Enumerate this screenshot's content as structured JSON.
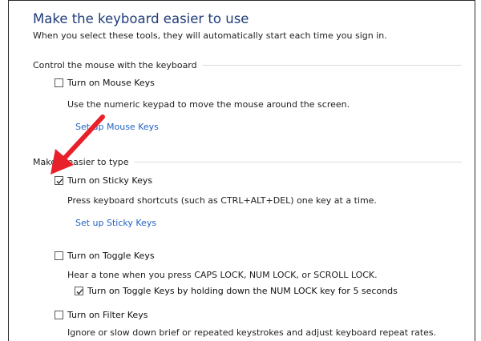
{
  "header": {
    "title": "Make the keyboard easier to use",
    "subtitle": "When you select these tools, they will automatically start each time you sign in."
  },
  "groups": {
    "mouse": {
      "header": "Control the mouse with the keyboard",
      "mouse_keys": {
        "label": "Turn on Mouse Keys",
        "checked": false,
        "description": "Use the numeric keypad to move the mouse around the screen.",
        "link": "Set up Mouse Keys"
      }
    },
    "typing": {
      "header": "Make it easier to type",
      "sticky_keys": {
        "label": "Turn on Sticky Keys",
        "checked": true,
        "description": "Press keyboard shortcuts (such as CTRL+ALT+DEL) one key at a time.",
        "link": "Set up Sticky Keys"
      },
      "toggle_keys": {
        "label": "Turn on Toggle Keys",
        "checked": false,
        "description": "Hear a tone when you press CAPS LOCK, NUM LOCK, or SCROLL LOCK.",
        "sub_option": {
          "label": "Turn on Toggle Keys by holding down the NUM LOCK key for 5 seconds",
          "checked": true
        }
      },
      "filter_keys": {
        "label": "Turn on Filter Keys",
        "checked": false,
        "description": "Ignore or slow down brief or repeated keystrokes and adjust keyboard repeat rates."
      }
    }
  },
  "annotation": {
    "arrow_color": "#e8202a",
    "arrow_icon": "red-arrow-icon"
  },
  "colors": {
    "title": "#1f3d78",
    "link": "#1f63c2"
  }
}
